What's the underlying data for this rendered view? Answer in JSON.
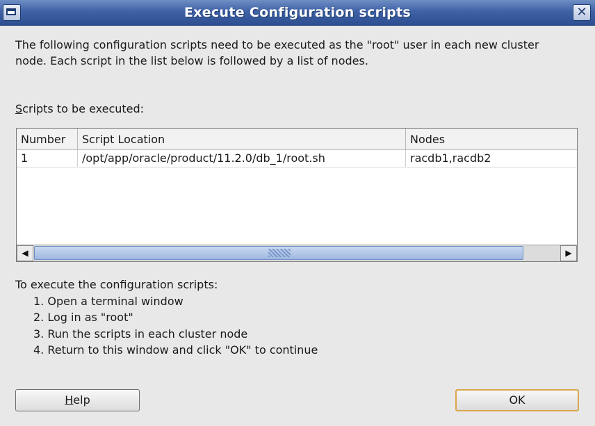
{
  "window": {
    "title": "Execute Configuration scripts",
    "close_glyph": "✕"
  },
  "intro_text": "The following configuration scripts need to be executed as the \"root\" user in each new cluster node. Each script in the list below is followed by a list of nodes.",
  "scripts_label_mnemonic": "S",
  "scripts_label_rest": "cripts to be executed:",
  "table": {
    "headers": [
      "Number",
      "Script Location",
      "Nodes"
    ],
    "rows": [
      [
        "1",
        "/opt/app/oracle/product/11.2.0/db_1/root.sh",
        "racdb1,racdb2"
      ]
    ]
  },
  "scrollbar": {
    "left_glyph": "◀",
    "right_glyph": "▶"
  },
  "instructions": {
    "heading": "To execute the configuration scripts:",
    "steps": [
      "1. Open a terminal window",
      "2. Log in as \"root\"",
      "3. Run the scripts in each cluster node",
      "4. Return to this window and click \"OK\" to continue"
    ]
  },
  "buttons": {
    "help_mnemonic": "H",
    "help_rest": "elp",
    "ok": "OK"
  },
  "colors": {
    "title_bar": "#3f62a6",
    "default_button_border": "#d9a64a"
  }
}
